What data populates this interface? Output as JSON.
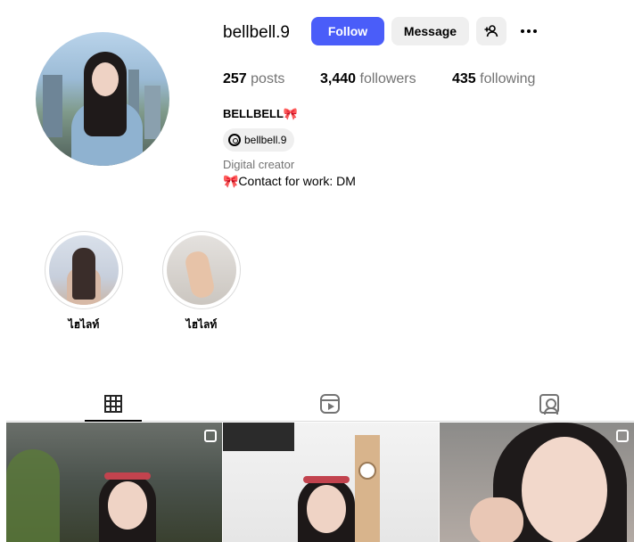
{
  "profile": {
    "username": "bellbell.9",
    "full_name": "BELLBELL🎀",
    "threads_handle": "bellbell.9",
    "category": "Digital creator",
    "bio": "🎀Contact for work: DM"
  },
  "actions": {
    "follow_label": "Follow",
    "message_label": "Message",
    "add_user_icon": "add-user-icon",
    "more_icon": "more-options-icon"
  },
  "stats": {
    "posts_count": "257",
    "posts_label": "posts",
    "followers_count": "3,440",
    "followers_label": "followers",
    "following_count": "435",
    "following_label": "following"
  },
  "highlights": [
    {
      "label": "ไฮไลท์"
    },
    {
      "label": "ไฮไลท์"
    }
  ],
  "tabs": [
    {
      "icon": "grid-icon",
      "active": true
    },
    {
      "icon": "reels-icon",
      "active": false
    },
    {
      "icon": "tagged-icon",
      "active": false
    }
  ],
  "colors": {
    "follow_button": "#4a5df9",
    "secondary_button": "#efefef",
    "muted_text": "#737373"
  }
}
